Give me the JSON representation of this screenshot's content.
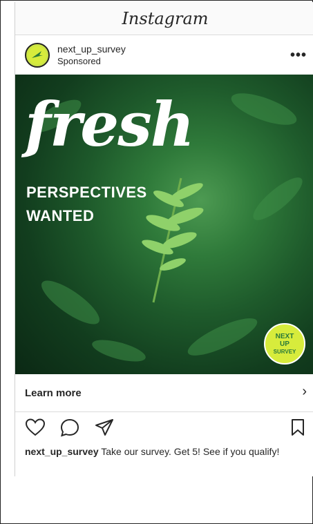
{
  "app": {
    "title": "Instagram"
  },
  "post": {
    "account": "next_up_survey",
    "label": "Sponsored",
    "more_label": "•••",
    "image": {
      "headline_script": "fresh",
      "headline_line1": "PERSPECTIVES",
      "headline_line2": "WANTED",
      "badge_line1": "NEXT",
      "badge_line2": "UP",
      "badge_line3": "SURVEY"
    },
    "cta": {
      "label": "Learn more",
      "chevron": "›"
    },
    "actions": [
      "heart-icon",
      "comment-icon",
      "share-icon",
      "bookmark-icon"
    ],
    "caption": {
      "user": "next_up_survey",
      "text": " Take our survey. Get 5! See if you qualify!"
    }
  },
  "colors": {
    "badge": "#d7ec3c",
    "text": "#262626",
    "divider": "#dbdbdb"
  }
}
